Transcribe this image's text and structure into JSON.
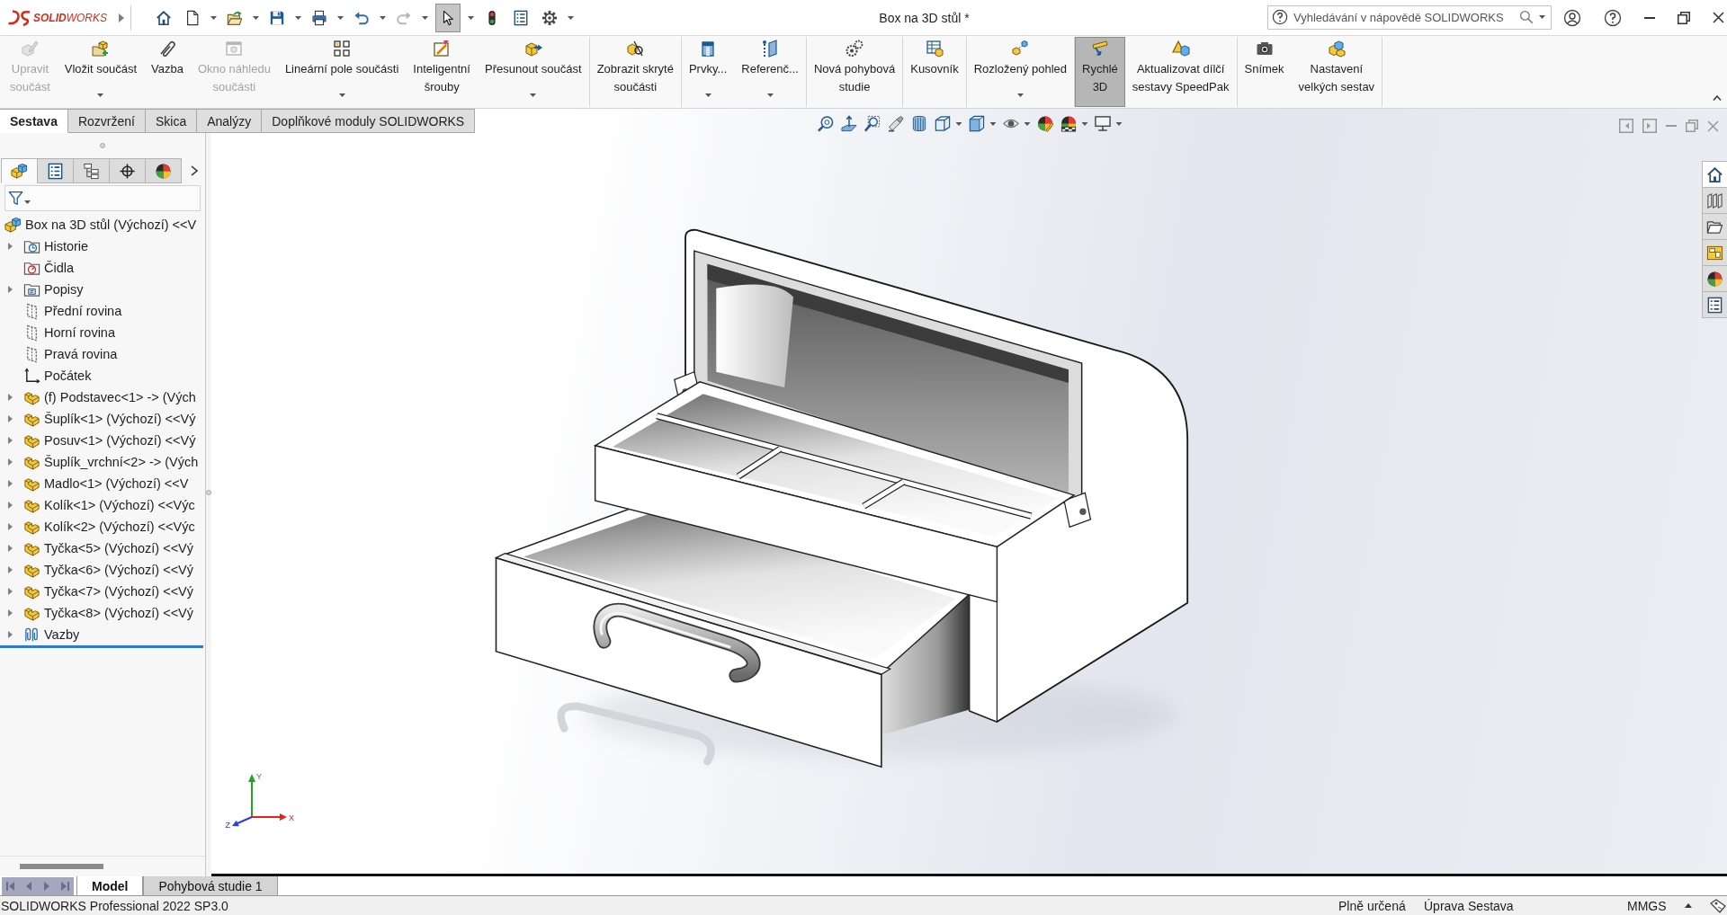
{
  "title_bar": {
    "logo": "**SOLID**WORKS",
    "title": "Box na 3D stůl *",
    "search": {
      "placeholder": "Vyhledávání v nápovědě SOLIDWORKS"
    }
  },
  "quick_access": [
    {
      "menu": false,
      "disabled": false,
      "selected": false
    },
    {
      "menu": true,
      "disabled": false,
      "selected": false
    },
    {
      "menu": true,
      "disabled": false,
      "selected": false
    },
    {
      "menu": true,
      "disabled": false,
      "selected": false
    },
    {
      "menu": true,
      "disabled": false,
      "selected": false
    },
    {
      "menu": true,
      "disabled": false,
      "selected": false
    },
    {
      "menu": true,
      "disabled": true,
      "selected": false
    },
    {
      "menu": true,
      "disabled": false,
      "selected": true
    },
    {
      "menu": false,
      "disabled": false,
      "selected": false
    },
    {
      "menu": false,
      "disabled": false,
      "selected": false
    },
    {
      "menu": true,
      "disabled": false,
      "selected": false
    }
  ],
  "command_groups": [
    {
      "buttons": [
        {
          "label": "Upravit\nsoučást",
          "menu": false,
          "disabled": true,
          "selected": false
        },
        {
          "label": "Vložit součást",
          "menu": true,
          "disabled": false,
          "selected": false
        },
        {
          "label": "Vazba",
          "menu": false,
          "disabled": false,
          "selected": false
        },
        {
          "label": "Okno náhledu\nsoučásti",
          "menu": false,
          "disabled": true,
          "selected": false
        },
        {
          "label": "Lineární pole součásti",
          "menu": true,
          "disabled": false,
          "selected": false
        },
        {
          "label": "Inteligentní\nšrouby",
          "menu": false,
          "disabled": false,
          "selected": false
        },
        {
          "label": "Přesunout součást",
          "menu": true,
          "disabled": false,
          "selected": false
        }
      ]
    },
    {
      "buttons": [
        {
          "label": "Zobrazit skryté\nsoučásti",
          "menu": false,
          "disabled": false,
          "selected": false
        }
      ]
    },
    {
      "buttons": [
        {
          "label": "Prvky...",
          "menu": true,
          "disabled": false,
          "selected": false
        },
        {
          "label": "Referenč...",
          "menu": true,
          "disabled": false,
          "selected": false
        }
      ]
    },
    {
      "buttons": [
        {
          "label": "Nová pohybová\nstudie",
          "menu": false,
          "disabled": false,
          "selected": false
        }
      ]
    },
    {
      "buttons": [
        {
          "label": "Kusovník",
          "menu": false,
          "disabled": false,
          "selected": false
        }
      ]
    },
    {
      "buttons": [
        {
          "label": "Rozložený pohled",
          "menu": true,
          "disabled": false,
          "selected": false
        }
      ]
    },
    {
      "buttons": [
        {
          "label": "Rychlé\n3D",
          "menu": false,
          "disabled": false,
          "selected": true
        },
        {
          "label": "Aktualizovat dílčí\nsestavy SpeedPak",
          "menu": false,
          "disabled": false,
          "selected": false
        }
      ]
    },
    {
      "buttons": [
        {
          "label": "Snímek",
          "menu": false,
          "disabled": false,
          "selected": false
        },
        {
          "label": "Nastavení\nvelkých sestav",
          "menu": false,
          "disabled": false,
          "selected": false
        }
      ]
    }
  ],
  "doc_tabs": [
    {
      "label": "Sestava",
      "selected": true
    },
    {
      "label": "Rozvržení",
      "selected": false
    },
    {
      "label": "Skica",
      "selected": false
    },
    {
      "label": "Analýzy",
      "selected": false
    },
    {
      "label": "Doplňkové moduly SOLIDWORKS",
      "selected": false
    }
  ],
  "feature_panel": {
    "tabs": [
      {
        "selected": true
      },
      {
        "selected": false
      },
      {
        "selected": false
      },
      {
        "selected": false
      },
      {
        "selected": false
      }
    ],
    "tree": {
      "label": "Box na 3D stůl (Výchozí) <<V",
      "kind": "assembly",
      "children": [
        {
          "label": "Historie",
          "kind": "history",
          "expandable": true
        },
        {
          "label": "Čidla",
          "kind": "sensors",
          "expandable": false
        },
        {
          "label": "Popisy",
          "kind": "annotations",
          "expandable": true
        },
        {
          "label": "Přední rovina",
          "kind": "plane",
          "expandable": false
        },
        {
          "label": "Horní rovina",
          "kind": "plane",
          "expandable": false
        },
        {
          "label": "Pravá rovina",
          "kind": "plane",
          "expandable": false
        },
        {
          "label": "Počátek",
          "kind": "origin",
          "expandable": false
        },
        {
          "label": "(f) Podstavec<1> -> (Vých",
          "kind": "part",
          "expandable": true
        },
        {
          "label": "Šuplík<1> (Výchozí) <<Vý",
          "kind": "part",
          "expandable": true
        },
        {
          "label": "Posuv<1> (Výchozí) <<Vý",
          "kind": "part",
          "expandable": true
        },
        {
          "label": "Šuplík_vrchní<2> -> (Vých",
          "kind": "part",
          "expandable": true
        },
        {
          "label": "Madlo<1> (Výchozí) <<V",
          "kind": "part",
          "expandable": true
        },
        {
          "label": "Kolík<1> (Výchozí) <<Výc",
          "kind": "part",
          "expandable": true
        },
        {
          "label": "Kolík<2> (Výchozí) <<Výc",
          "kind": "part",
          "expandable": true
        },
        {
          "label": "Tyčka<5> (Výchozí) <<Vý",
          "kind": "part",
          "expandable": true
        },
        {
          "label": "Tyčka<6> (Výchozí) <<Vý",
          "kind": "part",
          "expandable": true
        },
        {
          "label": "Tyčka<7> (Výchozí) <<Vý",
          "kind": "part",
          "expandable": true
        },
        {
          "label": "Tyčka<8> (Výchozí) <<Vý",
          "kind": "part",
          "expandable": true
        },
        {
          "label": "Vazby",
          "kind": "mates",
          "expandable": true
        }
      ]
    }
  },
  "graphics": {
    "triad": [
      {
        "kind": "up",
        "label": "Y",
        "color": "#27a127"
      },
      {
        "kind": "right",
        "label": "X",
        "color": "#e52020"
      },
      {
        "kind": "depth",
        "label": "Z",
        "color": "#2b3fd8"
      }
    ]
  },
  "task_pane": [
    {
      "selected": true
    },
    {
      "selected": false
    },
    {
      "selected": false
    },
    {
      "selected": false
    },
    {
      "selected": false
    },
    {
      "selected": false
    }
  ],
  "bottom_tabs": [
    {
      "label": "Model",
      "selected": true
    },
    {
      "label": "Pohybová studie 1",
      "selected": false
    }
  ],
  "status_bar": {
    "product": "SOLIDWORKS Professional 2022 SP3.0",
    "items": [
      "Plně určená",
      "Úprava Sestava",
      "MMGS"
    ]
  }
}
